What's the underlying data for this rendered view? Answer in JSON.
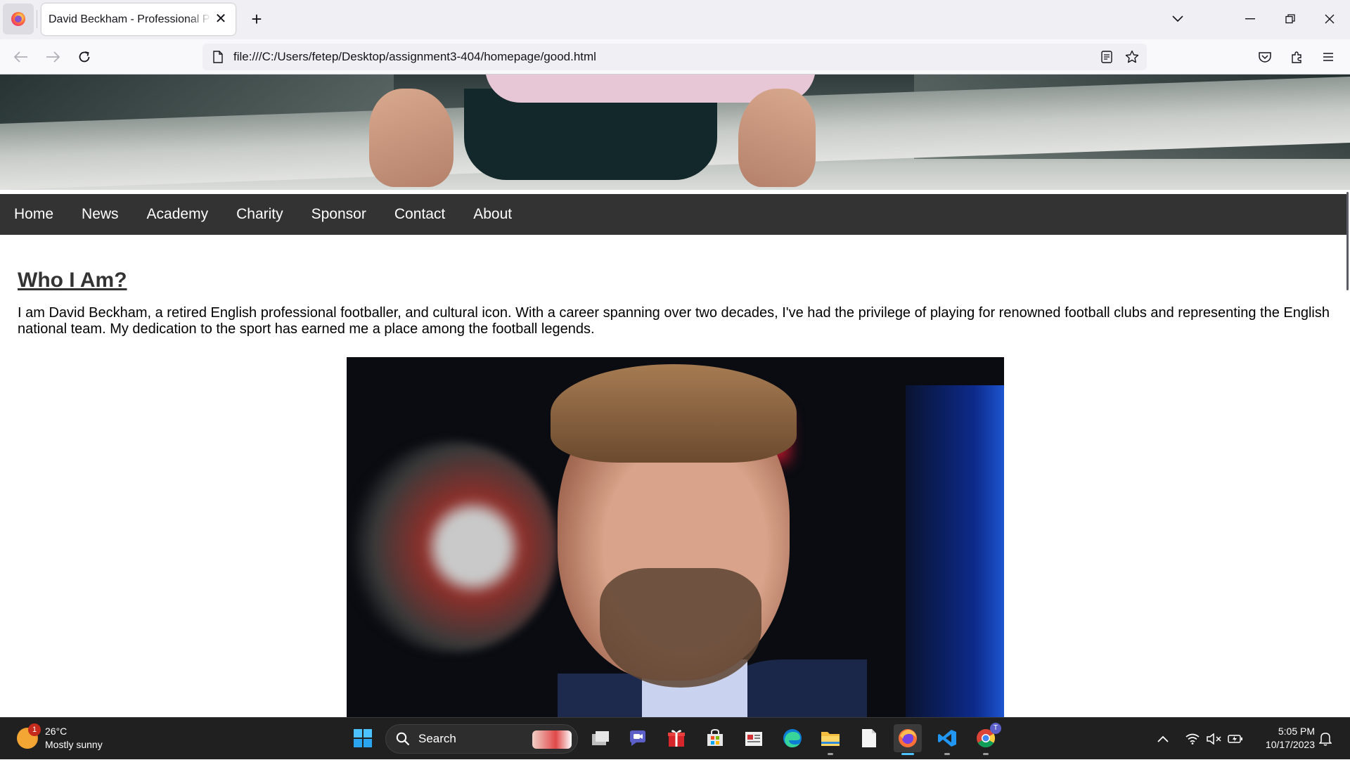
{
  "browser": {
    "tab_title": "David Beckham - Professional Profile",
    "url": "file:///C:/Users/fetep/Desktop/assignment3-404/homepage/good.html"
  },
  "site": {
    "nav_items": [
      "Home",
      "News",
      "Academy",
      "Charity",
      "Sponsor",
      "Contact",
      "About"
    ],
    "heading": "Who I Am?",
    "intro": "I am David Beckham, a retired English professional footballer, and cultural icon. With a career spanning over two decades, I've had the privilege of playing for renowned football clubs and representing the English national team. My dedication to the sport has earned me a place among the football legends."
  },
  "taskbar": {
    "weather_temp": "26°C",
    "weather_desc": "Mostly sunny",
    "weather_badge": "1",
    "search_label": "Search",
    "time": "5:05 PM",
    "date": "10/17/2023",
    "chrome_badge": "T"
  },
  "colors": {
    "site_nav_bg": "#333333",
    "taskbar_bg": "#202020",
    "accent": "#4cc2ff"
  }
}
